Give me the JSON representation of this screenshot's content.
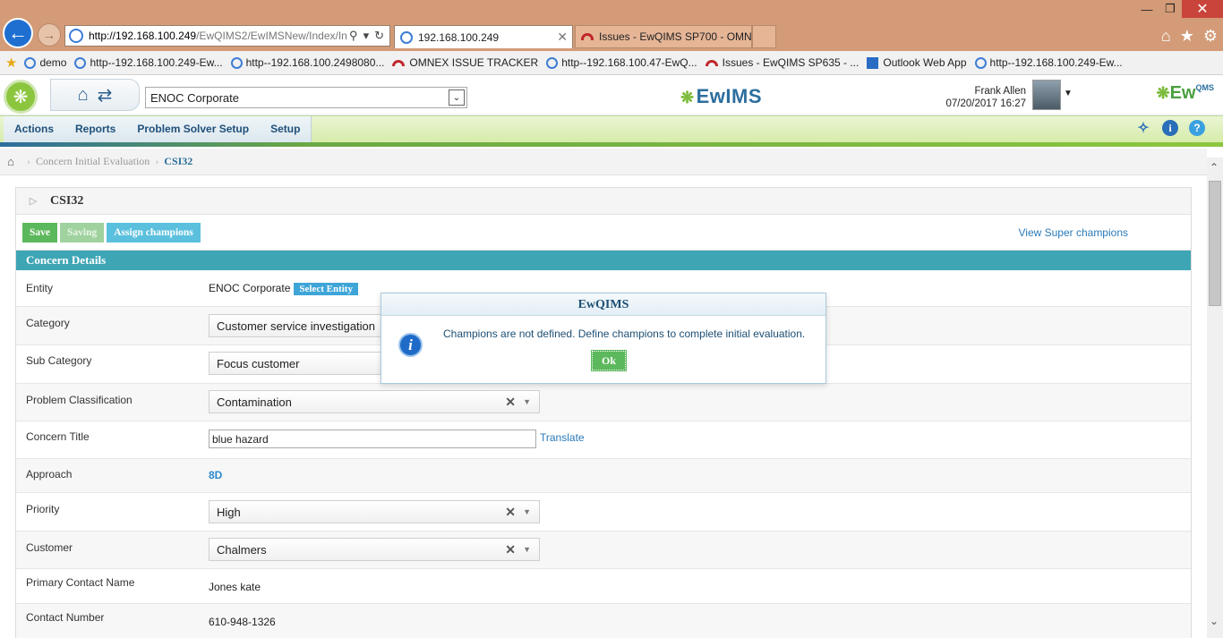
{
  "browser": {
    "url_host": "http://192.168.100.249",
    "url_rest": "/EwQIMS2/EwIMSNew/Index/In",
    "tabs": [
      {
        "label": "192.168.100.249"
      },
      {
        "label": "Issues - EwQIMS SP700 - OMN..."
      }
    ],
    "favorites": [
      {
        "label": "demo",
        "icon": "ie-icon"
      },
      {
        "label": "http--192.168.100.249-Ew...",
        "icon": "ie-icon"
      },
      {
        "label": "http--192.168.100.2498080...",
        "icon": "ie-icon"
      },
      {
        "label": "OMNEX ISSUE TRACKER",
        "icon": "omnex-icon"
      },
      {
        "label": "http--192.168.100.47-EwQ...",
        "icon": "ie-icon"
      },
      {
        "label": "Issues - EwQIMS SP635 - ...",
        "icon": "omnex-icon"
      },
      {
        "label": "Outlook Web App",
        "icon": "outlook-icon"
      },
      {
        "label": "http--192.168.100.249-Ew...",
        "icon": "ie-icon"
      }
    ]
  },
  "header": {
    "entity": "ENOC Corporate",
    "center_logo": "EwIMS",
    "user_name": "Frank Allen",
    "datetime": "07/20/2017 16:27",
    "right_logo": "Ew",
    "right_logo_sub": "QMS"
  },
  "menu": {
    "items": [
      "Actions",
      "Reports",
      "Problem Solver Setup",
      "Setup"
    ]
  },
  "breadcrumb": {
    "parent": "Concern Initial Evaluation",
    "current": "CSI32"
  },
  "panel": {
    "title": "CSI32",
    "save_label": "Save",
    "saving_label": "Saving",
    "assign_label": "Assign champions",
    "super_link": "View Super champions",
    "section_title": "Concern Details"
  },
  "form": {
    "entity_label": "Entity",
    "entity_value": "ENOC Corporate",
    "select_entity": "Select Entity",
    "category_label": "Category",
    "category_value": "Customer service investigation",
    "subcategory_label": "Sub Category",
    "subcategory_value": "Focus customer",
    "classification_label": "Problem Classification",
    "classification_value": "Contamination",
    "title_label": "Concern Title",
    "title_value": "blue hazard",
    "translate": "Translate",
    "approach_label": "Approach",
    "approach_value": "8D",
    "priority_label": "Priority",
    "priority_value": "High",
    "customer_label": "Customer",
    "customer_value": "Chalmers",
    "contact_name_label": "Primary Contact Name",
    "contact_name_value": "Jones kate",
    "contact_number_label": "Contact Number",
    "contact_number_value": "610-948-1326"
  },
  "modal": {
    "title": "EwQIMS",
    "message": "Champions are not defined. Define champions to complete initial evaluation.",
    "ok": "Ok"
  }
}
